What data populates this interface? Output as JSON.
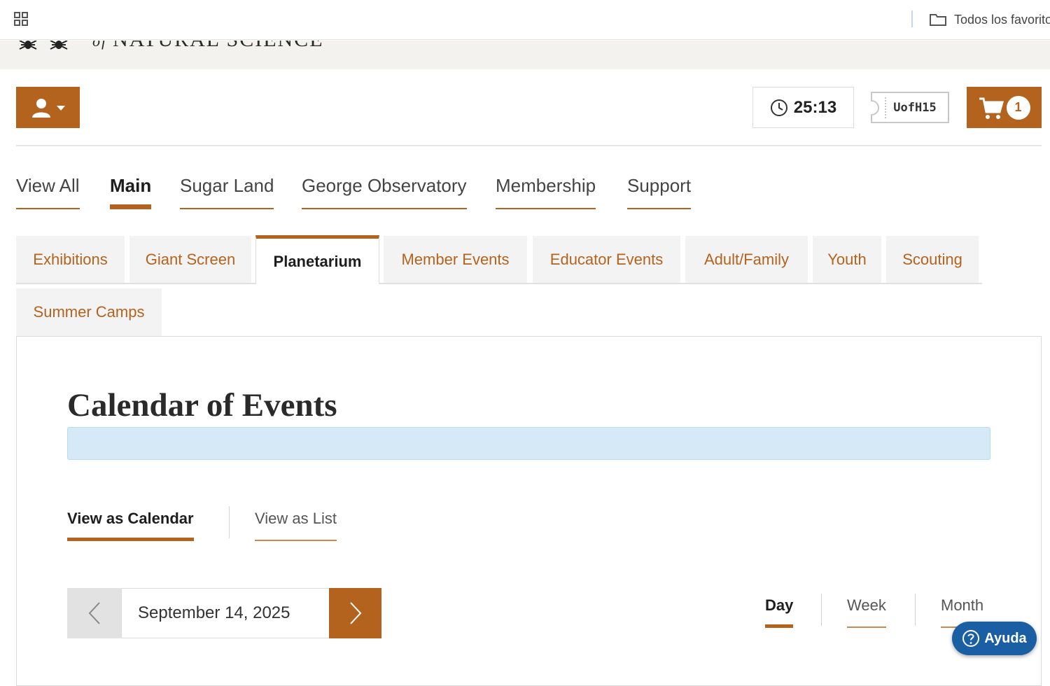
{
  "browser": {
    "bookmarks_label": "Todos los favoritos",
    "icons": {
      "apps": "apps-grid-icon",
      "folder": "folder-icon"
    }
  },
  "site": {
    "logo_text": "NATURAL SCIENCE",
    "logo_prefix": "of"
  },
  "header": {
    "timer": "25:13",
    "code": "UofH15",
    "cart_count": "1",
    "icons": {
      "user": "user-icon",
      "clock": "clock-icon",
      "cart": "cart-icon"
    }
  },
  "main_nav": {
    "items": [
      {
        "label": "View All",
        "active": false
      },
      {
        "label": "Main",
        "active": true
      },
      {
        "label": "Sugar Land",
        "active": false
      },
      {
        "label": "George Observatory",
        "active": false
      },
      {
        "label": "Membership",
        "active": false
      },
      {
        "label": "Support",
        "active": false
      }
    ]
  },
  "category_tabs": {
    "items": [
      {
        "label": "Exhibitions",
        "active": false
      },
      {
        "label": "Giant Screen",
        "active": false
      },
      {
        "label": "Planetarium",
        "active": true
      },
      {
        "label": "Member Events",
        "active": false
      },
      {
        "label": "Educator Events",
        "active": false
      },
      {
        "label": "Adult/Family",
        "active": false
      },
      {
        "label": "Youth",
        "active": false
      },
      {
        "label": "Scouting",
        "active": false
      },
      {
        "label": "Summer Camps",
        "active": false
      }
    ]
  },
  "calendar": {
    "title": "Calendar of Events",
    "view_tabs": [
      {
        "label": "View as Calendar",
        "active": true
      },
      {
        "label": "View as List",
        "active": false
      }
    ],
    "date": "September 14, 2025",
    "range_tabs": [
      {
        "label": "Day",
        "active": true
      },
      {
        "label": "Week",
        "active": false
      },
      {
        "label": "Month",
        "active": false
      }
    ]
  },
  "help": {
    "label": "Ayuda"
  },
  "colors": {
    "accent": "#b4631e",
    "info_bar": "#d5e9f6",
    "help_button": "#1a5ea4"
  }
}
